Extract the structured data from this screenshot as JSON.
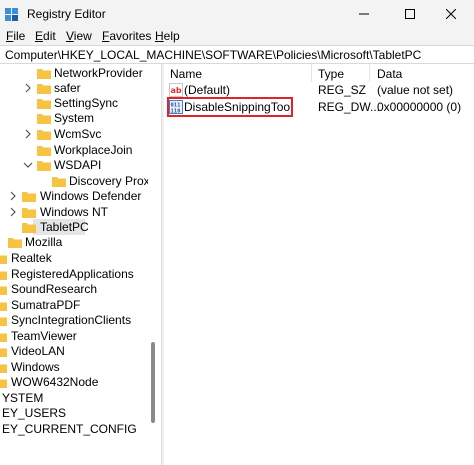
{
  "window": {
    "title": "Registry Editor",
    "minimize_glyph": "—",
    "close_glyph": "✕"
  },
  "menu": {
    "items": [
      {
        "label": "File",
        "underline": "F",
        "rest": "ile"
      },
      {
        "label": "Edit",
        "underline": "E",
        "rest": "dit"
      },
      {
        "label": "View",
        "underline": "V",
        "rest": "iew"
      },
      {
        "label": "Favorites",
        "underline": "F",
        "rest": "avorites"
      },
      {
        "label": "Help",
        "underline": "H",
        "rest": "elp"
      }
    ]
  },
  "address": {
    "path": "Computer\\HKEY_LOCAL_MACHINE\\SOFTWARE\\Policies\\Microsoft\\TabletPC"
  },
  "tree": {
    "items": [
      {
        "label": "NetworkProvider",
        "expander": "none"
      },
      {
        "label": "safer",
        "expander": "collapsed"
      },
      {
        "label": "SettingSync",
        "expander": "none"
      },
      {
        "label": "System",
        "expander": "none"
      },
      {
        "label": "WcmSvc",
        "expander": "collapsed"
      },
      {
        "label": "WorkplaceJoin",
        "expander": "none"
      },
      {
        "label": "WSDAPI",
        "expander": "expanded"
      },
      {
        "label": "Discovery Proxie",
        "expander": "none"
      },
      {
        "label": "Windows Defender",
        "expander": "collapsed"
      },
      {
        "label": "Windows NT",
        "expander": "collapsed"
      },
      {
        "label": "TabletPC",
        "expander": "none",
        "selected": true
      },
      {
        "label": "Mozilla",
        "expander": "collapsed"
      },
      {
        "label": "Realtek",
        "expander": "none"
      },
      {
        "label": "RegisteredApplications",
        "expander": "none"
      },
      {
        "label": "SoundResearch",
        "expander": "none"
      },
      {
        "label": "SumatraPDF",
        "expander": "none"
      },
      {
        "label": "SyncIntegrationClients",
        "expander": "none"
      },
      {
        "label": "TeamViewer",
        "expander": "none"
      },
      {
        "label": "VideoLAN",
        "expander": "none"
      },
      {
        "label": "Windows",
        "expander": "none"
      },
      {
        "label": "WOW6432Node",
        "expander": "none"
      },
      {
        "label": "YSTEM",
        "expander": "none"
      },
      {
        "label": "EY_USERS",
        "expander": "none"
      },
      {
        "label": "EY_CURRENT_CONFIG",
        "expander": "none"
      }
    ]
  },
  "list": {
    "columns": [
      "Name",
      "Type",
      "Data"
    ],
    "rows": [
      {
        "name": "(Default)",
        "type": "REG_SZ",
        "data": "(value not set)",
        "icon": "string-value-icon"
      },
      {
        "name": "DisableSnippingTool",
        "type": "REG_DW...",
        "data": "0x00000000 (0)",
        "icon": "binary-value-icon",
        "highlighted": true
      }
    ]
  },
  "colors": {
    "folder": "#f6c342",
    "highlight_border": "#e0222a",
    "selected_bg": "#e5e5e5",
    "chrome_bg": "#f3f3f3"
  }
}
